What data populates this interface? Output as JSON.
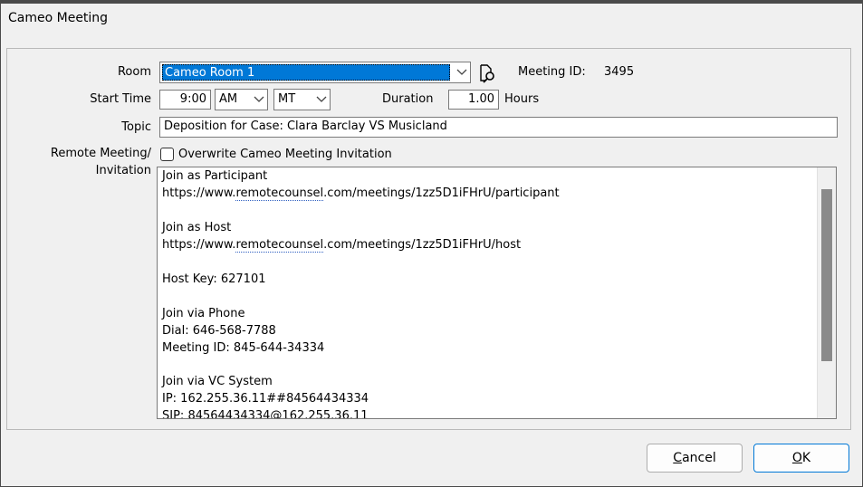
{
  "window": {
    "title": "Cameo Meeting"
  },
  "form": {
    "room_label": "Room",
    "room_value": "Cameo Room 1",
    "meeting_id_label": "Meeting ID:",
    "meeting_id_value": "3495",
    "start_time_label": "Start Time",
    "start_time_value": "9:00",
    "ampm_value": "AM",
    "timezone_value": "MT",
    "duration_label": "Duration",
    "duration_value": "1.00",
    "hours_label": "Hours",
    "topic_label": "Topic",
    "topic_value": "Deposition for Case: Clara Barclay VS Musicland",
    "remote_label_line1": "Remote Meeting/",
    "remote_label_line2": "Invitation",
    "overwrite_label": "Overwrite Cameo Meeting Invitation",
    "overwrite_checked": false
  },
  "invitation": {
    "line1": "Join as Participant",
    "line2_prefix": "https://www.",
    "line2_link": "remotecounsel",
    "line2_suffix": ".com/meetings/1zz5D1iFHrU/participant",
    "line3": "Join as Host",
    "line4_prefix": "https://www.",
    "line4_link": "remotecounsel",
    "line4_suffix": ".com/meetings/1zz5D1iFHrU/host",
    "line5": "Host Key: 627101",
    "line6": "Join via Phone",
    "line7": "Dial: 646-568-7788",
    "line8": "Meeting ID: 845-644-34334",
    "line9": "Join via VC System",
    "line10": "IP: 162.255.36.11##84564434334",
    "line11": "SIP: 84564434334@162.255.36.11"
  },
  "buttons": {
    "cancel_first": "C",
    "cancel_rest": "ancel",
    "ok_first": "O",
    "ok_rest": "K"
  },
  "colors": {
    "selection": "#0078d7",
    "ok_border": "#0078d7",
    "scroll_thumb": "#8a8a8a"
  }
}
